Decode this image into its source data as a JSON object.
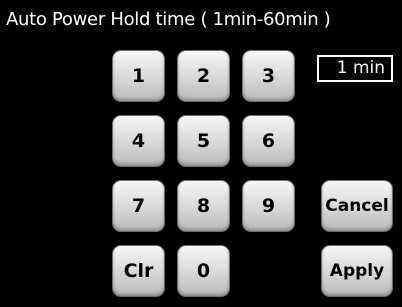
{
  "title": "Auto Power Hold time ( 1min-60min )",
  "value": "1 min",
  "keys": {
    "k1": "1",
    "k2": "2",
    "k3": "3",
    "k4": "4",
    "k5": "5",
    "k6": "6",
    "k7": "7",
    "k8": "8",
    "k9": "9",
    "k0": "0",
    "clear": "Clr",
    "cancel": "Cancel",
    "apply": "Apply"
  },
  "colors": {
    "background": "#000000",
    "text": "#ffffff",
    "key_face": "#d7d7d7",
    "key_text": "#000000"
  }
}
